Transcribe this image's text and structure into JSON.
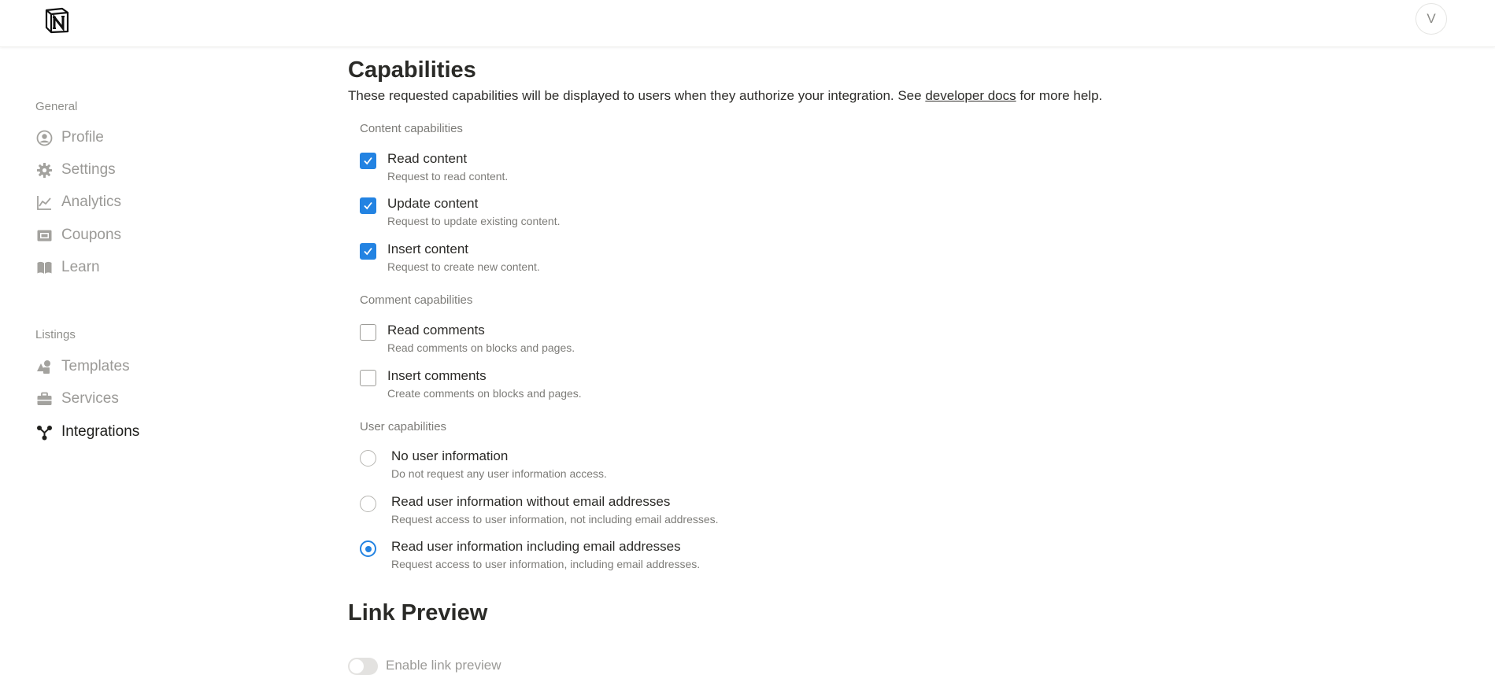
{
  "header": {
    "avatar_initial": "V"
  },
  "sidebar": {
    "general_label": "General",
    "general_items": [
      {
        "label": "Profile",
        "icon": "profile-icon"
      },
      {
        "label": "Settings",
        "icon": "gear-icon"
      },
      {
        "label": "Analytics",
        "icon": "chart-icon"
      },
      {
        "label": "Coupons",
        "icon": "ticket-icon"
      },
      {
        "label": "Learn",
        "icon": "book-icon"
      }
    ],
    "listings_label": "Listings",
    "listings_items": [
      {
        "label": "Templates",
        "icon": "shapes-icon"
      },
      {
        "label": "Services",
        "icon": "briefcase-icon"
      },
      {
        "label": "Integrations",
        "icon": "integrations-icon",
        "active": true
      }
    ]
  },
  "main": {
    "capabilities_title": "Capabilities",
    "intro_before": "These requested capabilities will be displayed to users when they authorize your integration. See ",
    "intro_link": "developer docs",
    "intro_after": " for more help.",
    "content_label": "Content capabilities",
    "content_options": [
      {
        "title": "Read content",
        "desc": "Request to read content.",
        "checked": true
      },
      {
        "title": "Update content",
        "desc": "Request to update existing content.",
        "checked": true
      },
      {
        "title": "Insert content",
        "desc": "Request to create new content.",
        "checked": true
      }
    ],
    "comment_label": "Comment capabilities",
    "comment_options": [
      {
        "title": "Read comments",
        "desc": "Read comments on blocks and pages.",
        "checked": false
      },
      {
        "title": "Insert comments",
        "desc": "Create comments on blocks and pages.",
        "checked": false
      }
    ],
    "user_label": "User capabilities",
    "user_options": [
      {
        "title": "No user information",
        "desc": "Do not request any user information access.",
        "selected": false
      },
      {
        "title": "Read user information without email addresses",
        "desc": "Request access to user information, not including email addresses.",
        "selected": false
      },
      {
        "title": "Read user information including email addresses",
        "desc": "Request access to user information, including email addresses.",
        "selected": true
      }
    ],
    "link_preview_title": "Link Preview",
    "link_preview_toggle_label": "Enable link preview",
    "link_preview_enabled": false
  },
  "colors": {
    "accent": "#2383e2",
    "muted_text": "#9b9a97",
    "primary_text": "#37352f"
  }
}
